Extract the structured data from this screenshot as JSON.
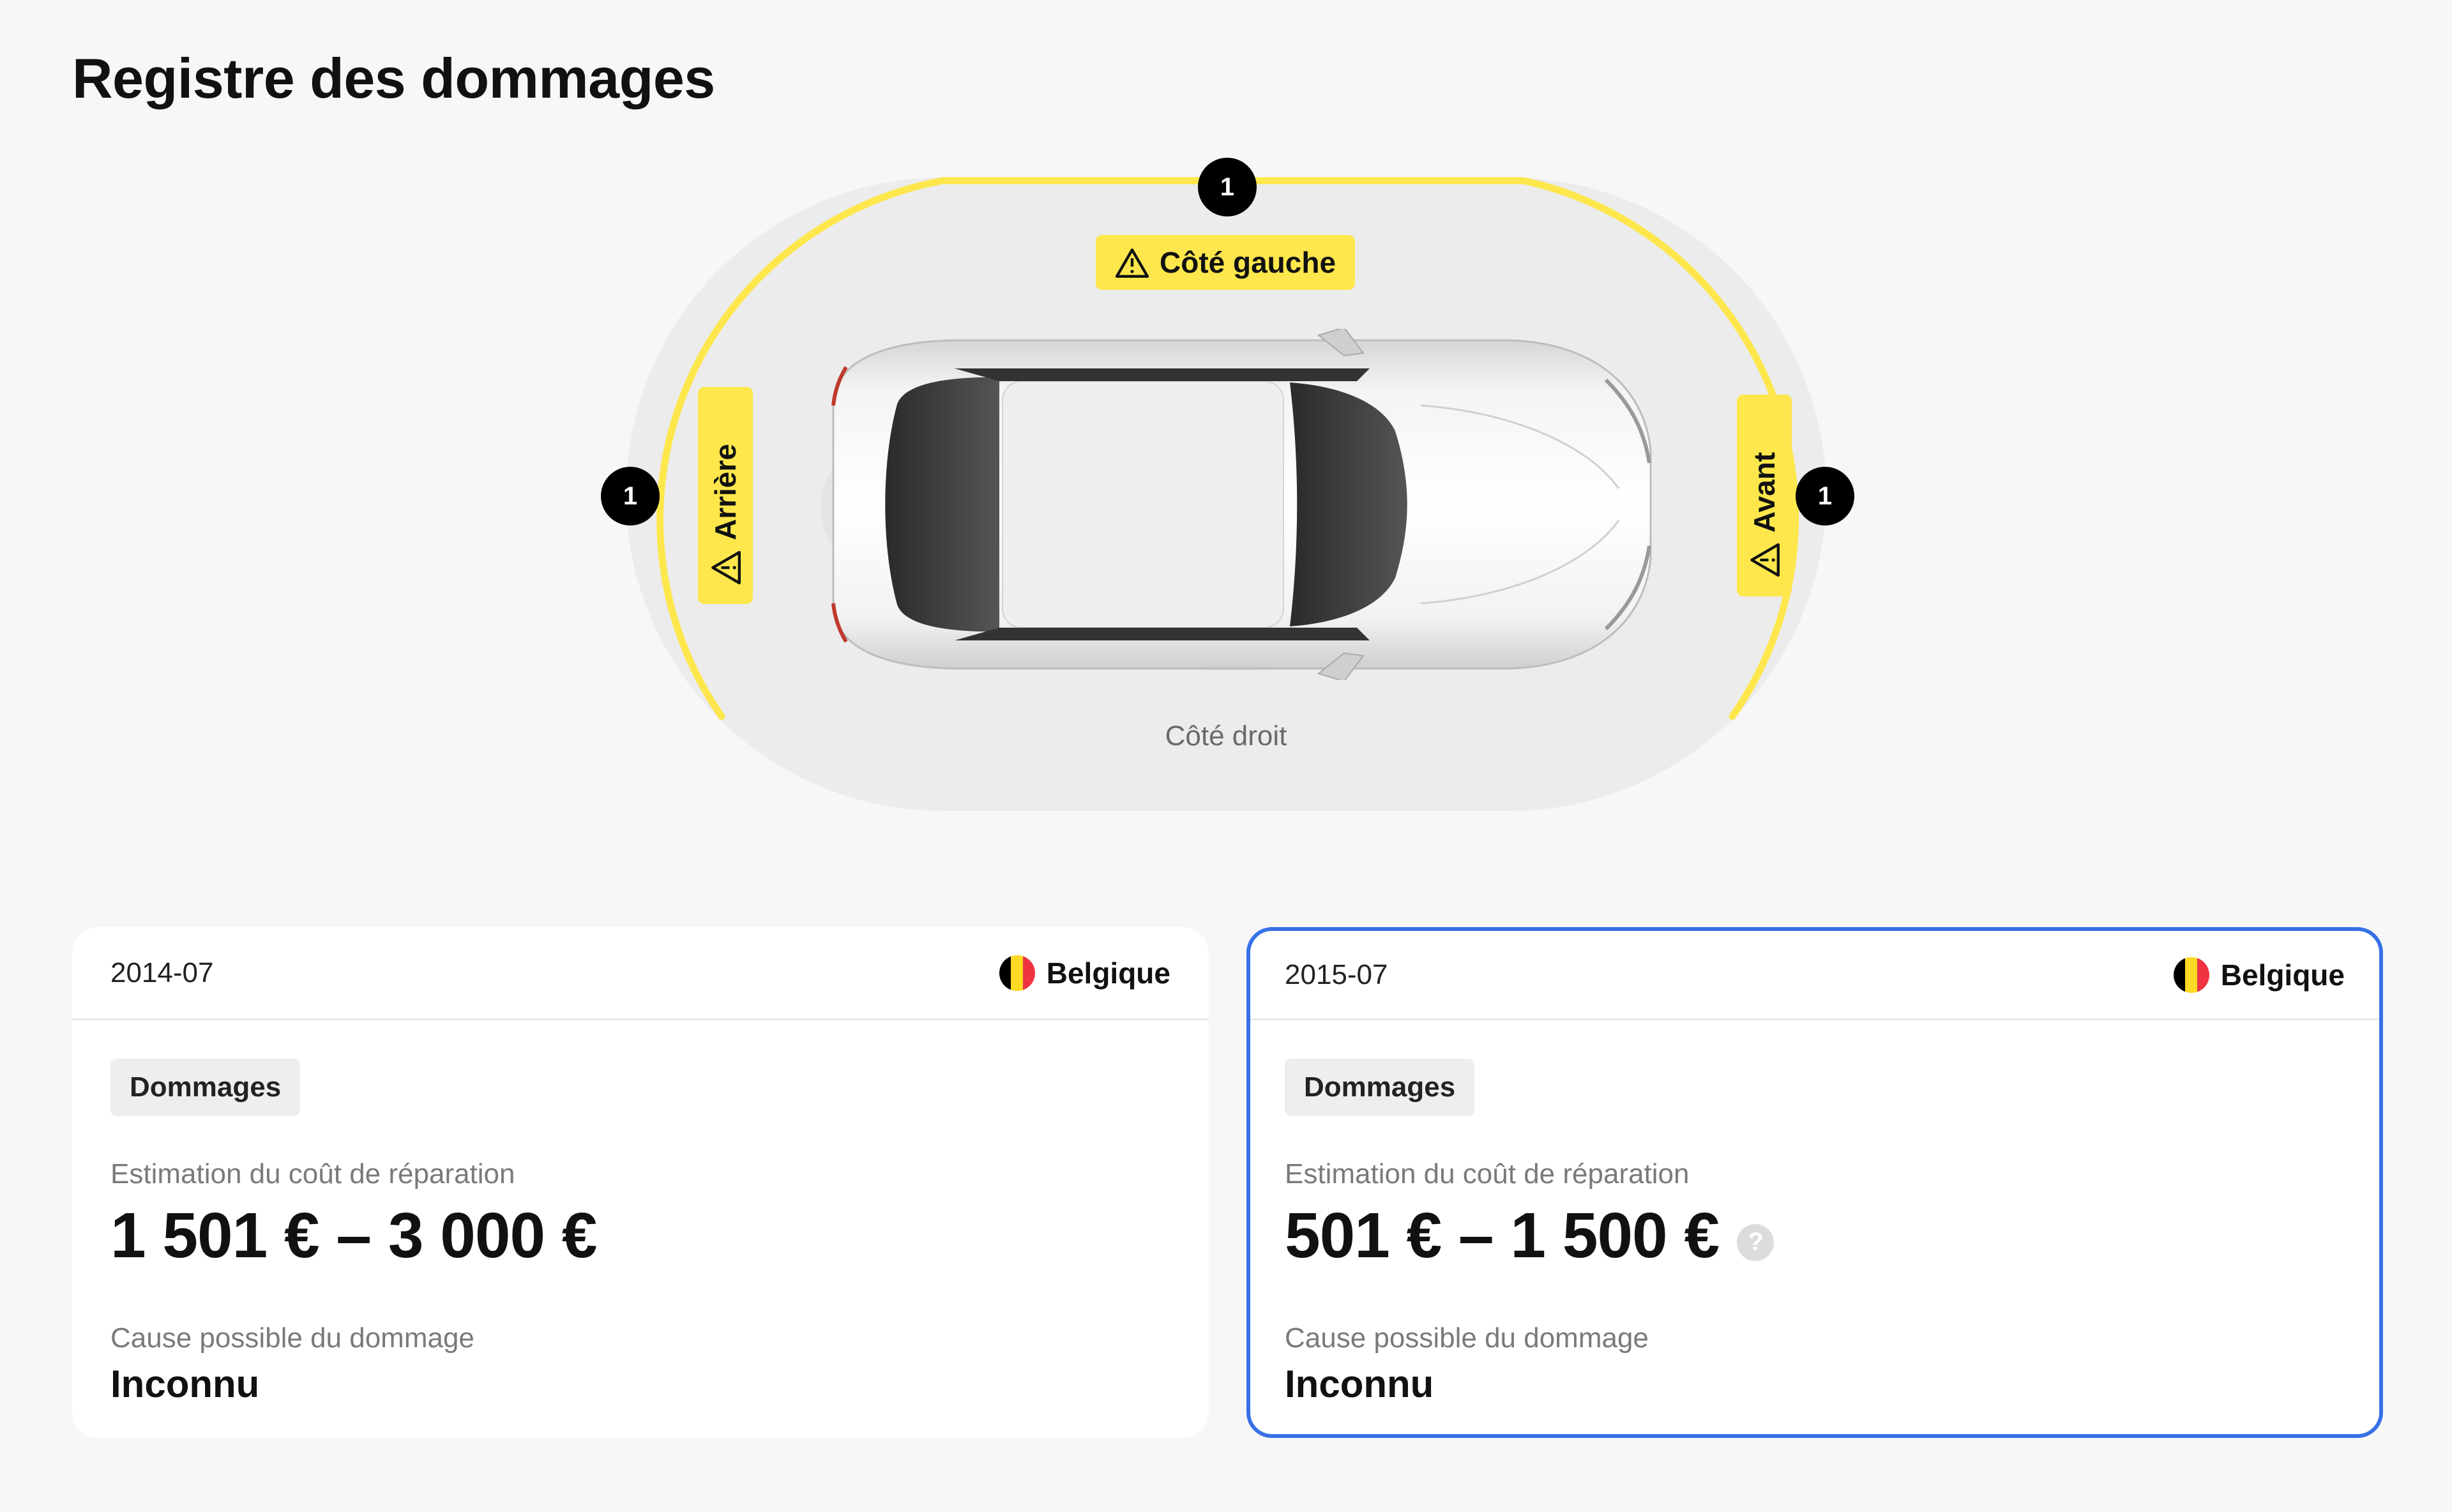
{
  "page": {
    "title": "Registre des dommages"
  },
  "diagram": {
    "zones": {
      "left_side": {
        "label": "Côté gauche",
        "count": "1",
        "icon": "warning-icon"
      },
      "rear": {
        "label": "Arrière",
        "count": "1",
        "icon": "warning-icon"
      },
      "front": {
        "label": "Avant",
        "count": "1",
        "icon": "warning-icon"
      },
      "right_side": {
        "label": "Côté droit"
      }
    },
    "colors": {
      "highlight": "#fde74c",
      "badge": "#000000",
      "zone_bg": "#ececec"
    }
  },
  "records": [
    {
      "date": "2014-07",
      "country": "Belgique",
      "flag_icon": "belgium-flag-icon",
      "tag": "Dommages",
      "cost_label": "Estimation du coût de réparation",
      "cost_value": "1 501 € – 3 000 €",
      "cause_label": "Cause possible du dommage",
      "cause_value": "Inconnu"
    },
    {
      "date": "2015-07",
      "country": "Belgique",
      "flag_icon": "belgium-flag-icon",
      "tag": "Dommages",
      "cost_label": "Estimation du coût de réparation",
      "cost_value": "501 € – 1 500 €",
      "help_icon": "help-icon",
      "help_text": "?",
      "cause_label": "Cause possible du dommage",
      "cause_value": "Inconnu",
      "selected": true,
      "selected_color": "#3770e6"
    }
  ]
}
